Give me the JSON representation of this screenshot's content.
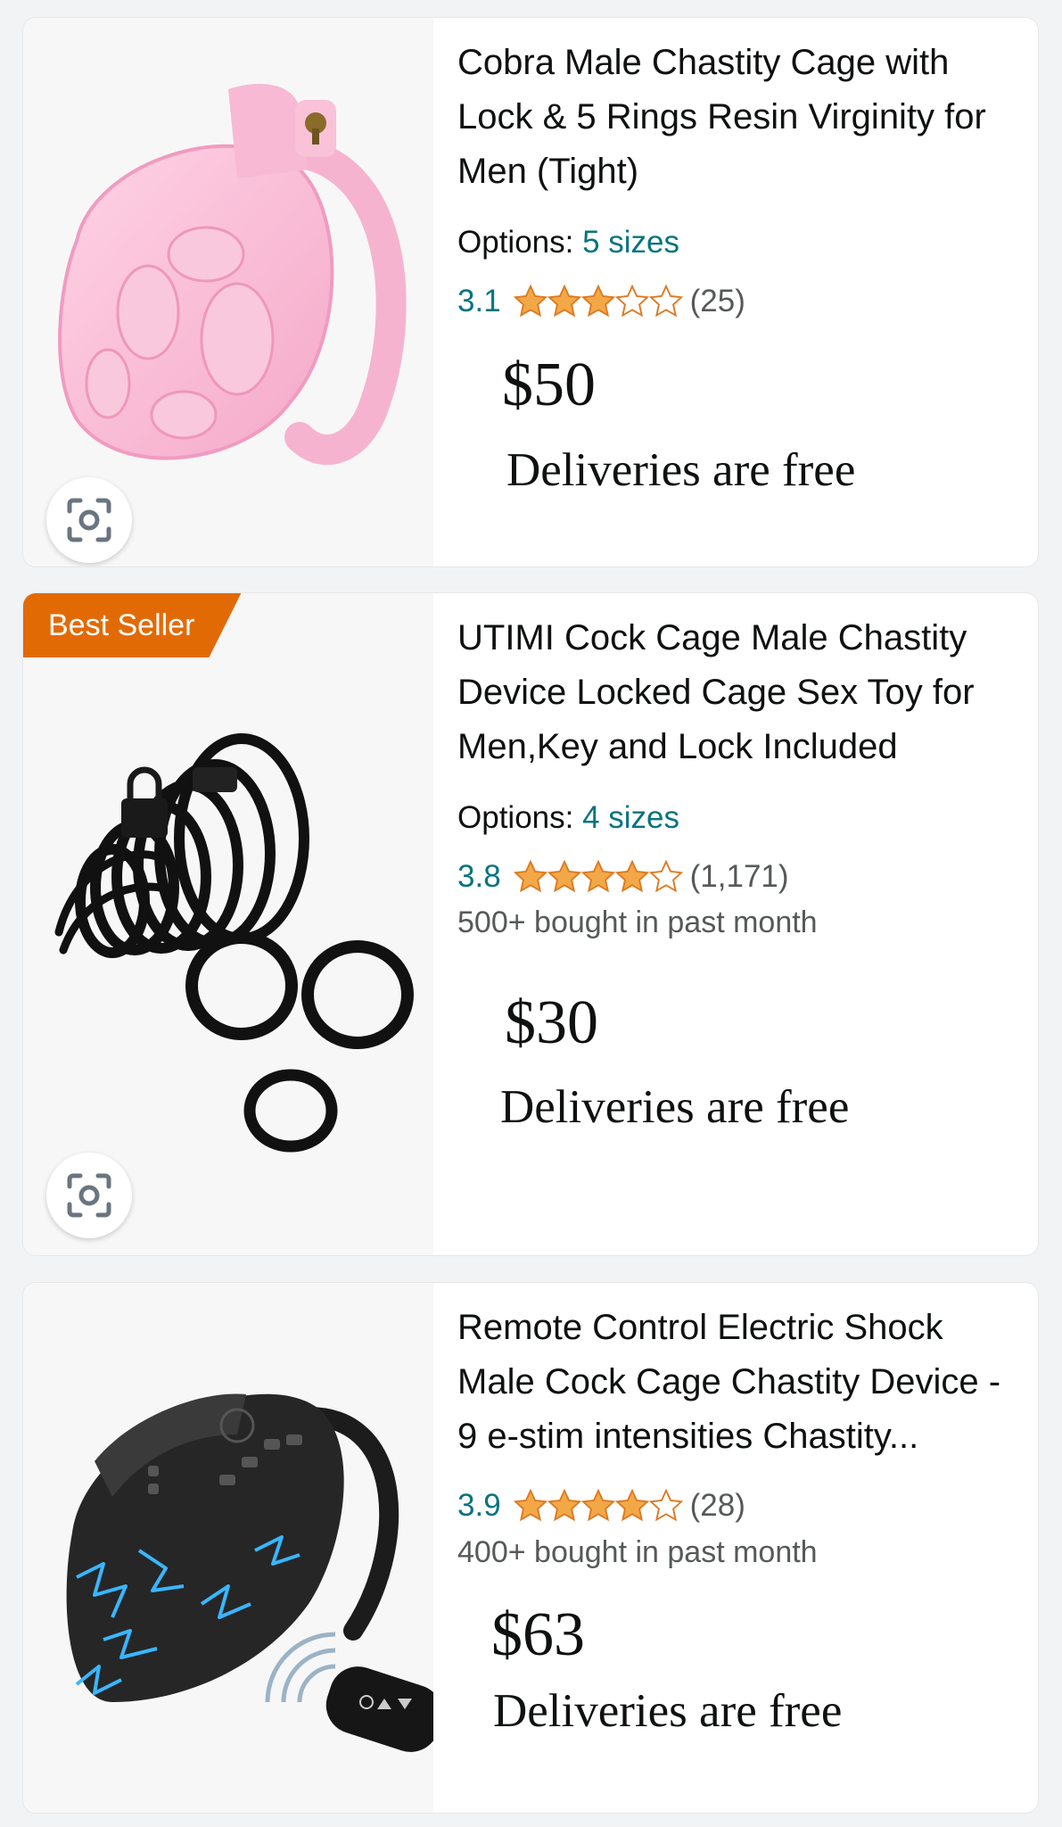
{
  "products": [
    {
      "title": "Cobra Male Chastity Cage with Lock & 5 Rings Resin Virginity for Men (Tight)",
      "options_label": "Options:",
      "options_value": "5 sizes",
      "rating": "3.1",
      "stars": 3,
      "review_count": "(25)",
      "price": "$50",
      "delivery": "Deliveries are free",
      "image_icon": "pink-cage-product-image"
    },
    {
      "badge": "Best Seller",
      "title": "UTIMI Cock Cage Male Chastity Device Locked Cage Sex Toy for Men,Key and Lock Included",
      "options_label": "Options:",
      "options_value": "4 sizes",
      "rating": "3.8",
      "stars": 4,
      "review_count": "(1,171)",
      "bought": "500+ bought in past month",
      "price": "$30",
      "delivery": "Deliveries are free",
      "image_icon": "black-cage-rings-product-image"
    },
    {
      "title": "Remote Control Electric Shock Male Cock Cage Chastity Device - 9 e-stim intensities Chastity...",
      "rating": "3.9",
      "stars": 4,
      "review_count": "(28)",
      "bought": "400+ bought in past month",
      "price": "$63",
      "delivery": "Deliveries are free",
      "image_icon": "electric-cage-remote-product-image"
    }
  ],
  "icons": {
    "visual_search": "camera-lens-icon",
    "star_full": "star-icon",
    "star_empty": "star-outline-icon"
  },
  "colors": {
    "link": "#087480",
    "star": "#f3a847",
    "badge": "#e26a05",
    "text": "#0f1111",
    "muted": "#565959"
  }
}
